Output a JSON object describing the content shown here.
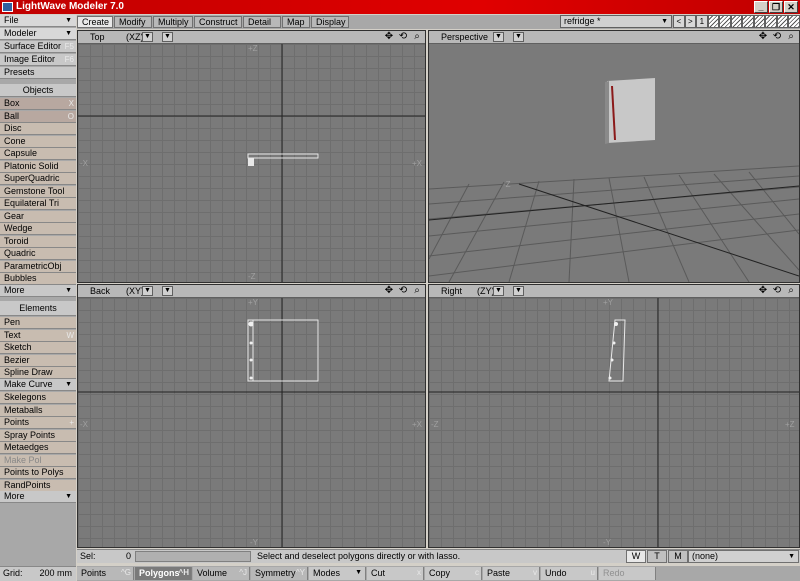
{
  "window": {
    "title": "LightWave Modeler 7.0",
    "minimize": "_",
    "restore": "❐",
    "close": "✕"
  },
  "sidebar": {
    "file": "File",
    "modeler": "Modeler",
    "surface_editor": "Surface Editor",
    "surface_editor_key": "F5",
    "image_editor": "Image Editor",
    "image_editor_key": "F6",
    "presets": "Presets",
    "objects_header": "Objects",
    "objects": [
      {
        "label": "Box",
        "key": "X"
      },
      {
        "label": "Ball",
        "key": "O"
      },
      {
        "label": "Disc",
        "key": ""
      },
      {
        "label": "Cone",
        "key": ""
      },
      {
        "label": "Capsule",
        "key": ""
      },
      {
        "label": "Platonic Solid",
        "key": ""
      },
      {
        "label": "SuperQuadric",
        "key": ""
      },
      {
        "label": "Gemstone Tool",
        "key": ""
      },
      {
        "label": "Equilateral Tri",
        "key": ""
      },
      {
        "label": "Gear",
        "key": ""
      },
      {
        "label": "Wedge",
        "key": ""
      },
      {
        "label": "Toroid",
        "key": ""
      },
      {
        "label": "Quadric",
        "key": ""
      },
      {
        "label": "ParametricObj",
        "key": ""
      },
      {
        "label": "Bubbles",
        "key": ""
      }
    ],
    "objects_more": "More",
    "elements_header": "Elements",
    "elements": [
      {
        "label": "Pen",
        "key": ""
      },
      {
        "label": "Text",
        "key": "W"
      },
      {
        "label": "Sketch",
        "key": ""
      },
      {
        "label": "Bezier",
        "key": ""
      },
      {
        "label": "Spline Draw",
        "key": ""
      }
    ],
    "make_curve": "Make Curve",
    "elements2": [
      {
        "label": "Skelegons",
        "key": ""
      },
      {
        "label": "Metaballs",
        "key": ""
      },
      {
        "label": "Points",
        "key": "+"
      },
      {
        "label": "Spray Points",
        "key": ""
      },
      {
        "label": "Metaedges",
        "key": ""
      },
      {
        "label": "Make Pol",
        "key": ""
      },
      {
        "label": "Points to Polys",
        "key": ""
      },
      {
        "label": "RandPoints",
        "key": ""
      }
    ],
    "elements_more": "More",
    "grid_label": "Grid:",
    "grid_value": "200 mm"
  },
  "tabs": [
    "Create",
    "Modify",
    "Multiply",
    "Construct",
    "Detail",
    "Map",
    "Display"
  ],
  "active_tab": "Create",
  "object_name": "refridge *",
  "layer_num": "1",
  "viewports": {
    "top": {
      "name": "Top",
      "axis": "(XZ)",
      "labels": {
        "top": "+Z",
        "bottom": "-Z",
        "left": "-X",
        "right": "+X"
      }
    },
    "perspective": {
      "name": "Perspective",
      "labels": {
        "z": "-Z"
      }
    },
    "back": {
      "name": "Back",
      "axis": "(XY)",
      "labels": {
        "top": "+Y",
        "bottom": "-Y",
        "left": "-X",
        "right": "+X"
      }
    },
    "right": {
      "name": "Right",
      "axis": "(ZY)",
      "labels": {
        "top": "+Y",
        "bottom": "-Y",
        "left": "-Z",
        "right": "+Z"
      }
    }
  },
  "status": {
    "sel_label": "Sel:",
    "sel_count": "0",
    "message": "Select and deselect polygons directly or with lasso.",
    "w": "W",
    "t": "T",
    "m": "M",
    "surface": "(none)"
  },
  "bottom": {
    "points": "Points",
    "points_key": "^G",
    "polygons": "Polygons",
    "polygons_key": "^H",
    "volume": "Volume",
    "volume_key": "^J",
    "symmetry": "Symmetry",
    "symmetry_key": "^Y",
    "modes": "Modes",
    "cut": "Cut",
    "cut_key": "x",
    "copy": "Copy",
    "copy_key": "c",
    "paste": "Paste",
    "paste_key": "v",
    "undo": "Undo",
    "undo_key": "u",
    "redo": "Redo"
  }
}
